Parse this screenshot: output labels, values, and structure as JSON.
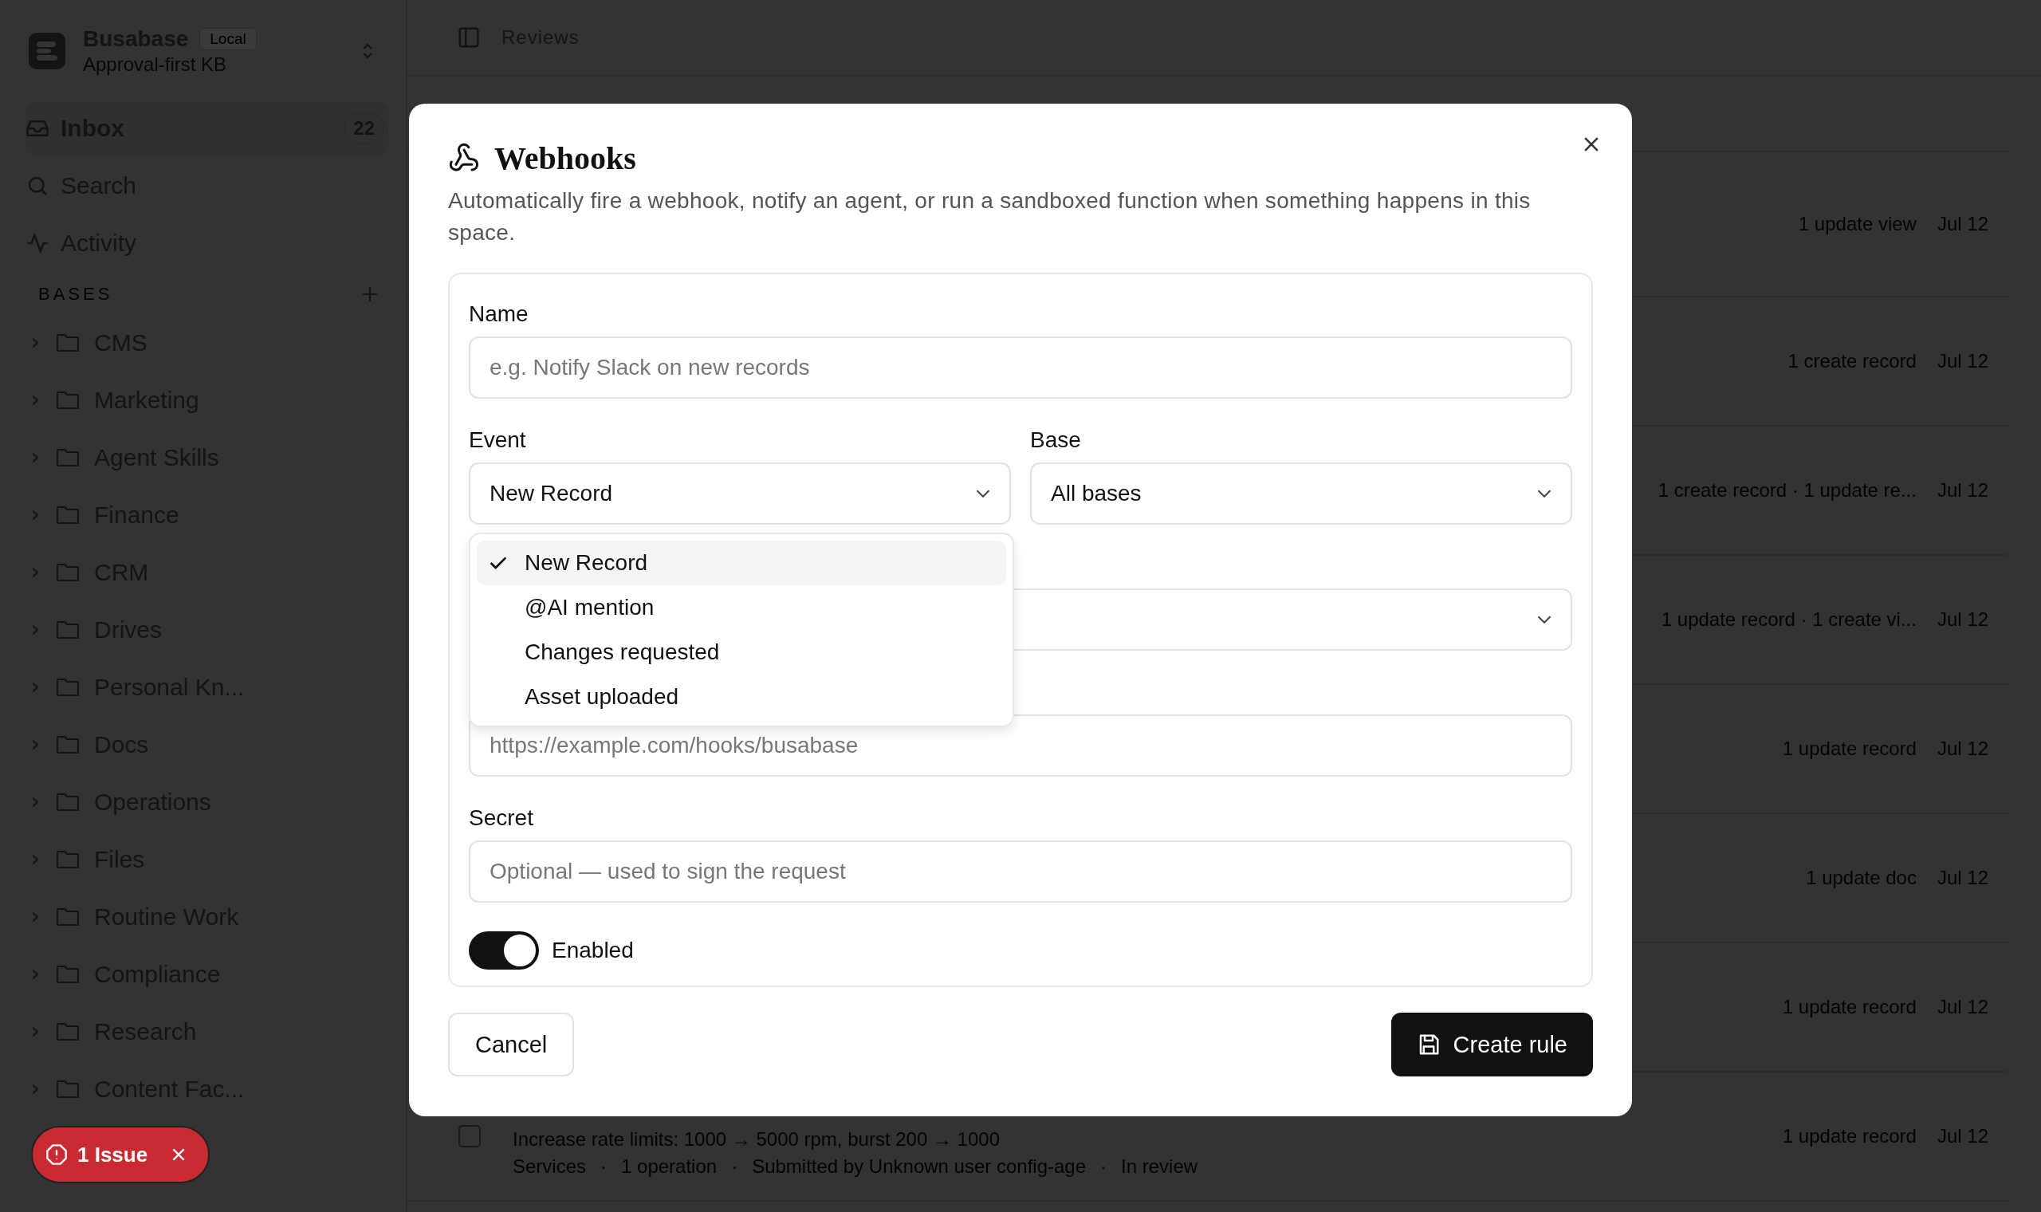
{
  "sidebar": {
    "workspace": {
      "name": "Busabase",
      "badge": "Local",
      "subtitle": "Approval-first KB"
    },
    "nav": [
      {
        "label": "Inbox",
        "count": "22",
        "selected": true
      },
      {
        "label": "Search",
        "selected": false
      },
      {
        "label": "Activity",
        "selected": false
      }
    ],
    "section_title": "BASES",
    "bases": [
      {
        "label": "CMS",
        "expanded": false
      },
      {
        "label": "Marketing",
        "expanded": false
      },
      {
        "label": "Agent Skills",
        "expanded": false
      },
      {
        "label": "Finance",
        "expanded": false
      },
      {
        "label": "CRM",
        "expanded": false
      },
      {
        "label": "Drives",
        "expanded": false
      },
      {
        "label": "Personal Kn...",
        "expanded": false
      },
      {
        "label": "Docs",
        "expanded": false
      },
      {
        "label": "Operations",
        "expanded": false
      },
      {
        "label": "Files",
        "expanded": false
      },
      {
        "label": "Routine Work",
        "expanded": false
      },
      {
        "label": "Compliance",
        "expanded": false
      },
      {
        "label": "Research",
        "expanded": false
      },
      {
        "label": "Content Fac...",
        "expanded": false
      }
    ]
  },
  "issue_pill": {
    "label": "1 Issue"
  },
  "header": {
    "title": "Reviews"
  },
  "reviews": [
    {
      "summary": "1 update view",
      "date": "Jul 12"
    },
    {
      "summary": "1 create record",
      "date": "Jul 12"
    },
    {
      "summary": "1 create record · 1 update re...",
      "date": "Jul 12"
    },
    {
      "summary": "1 update record · 1 create vi...",
      "date": "Jul 12"
    },
    {
      "summary": "1 update record",
      "date": "Jul 12"
    },
    {
      "summary": "1 update doc",
      "date": "Jul 12"
    },
    {
      "summary": "1 update record",
      "date": "Jul 12"
    },
    {
      "summary": "1 update record",
      "date": "Jul 12",
      "checked": false,
      "description": "Increase rate limits: 1000 → 5000 rpm, burst 200 → 1000",
      "meta": [
        "Services",
        "1 operation",
        "Submitted by Unknown user config-age",
        "In review"
      ],
      "separator": "·"
    }
  ],
  "dialog": {
    "title": "Webhooks",
    "description": "Automatically fire a webhook, notify an agent, or run a sandboxed function when something happens in this space.",
    "rows": [
      [
        {
          "kind": "text",
          "label": "Name",
          "placeholder": "e.g. Notify Slack on new records"
        }
      ],
      [
        {
          "kind": "select",
          "label": "Event",
          "value": "New Record",
          "options": [
            {
              "label": "New Record",
              "selected": true
            },
            {
              "label": "@AI mention",
              "selected": false
            },
            {
              "label": "Changes requested",
              "selected": false
            },
            {
              "label": "Asset uploaded",
              "selected": false
            }
          ]
        },
        {
          "kind": "select",
          "label": "Base",
          "value": "All bases"
        }
      ],
      [
        {
          "kind": "select"
        }
      ],
      [
        {
          "kind": "text",
          "placeholder": "https://example.com/hooks/busabase"
        }
      ],
      [
        {
          "kind": "text",
          "label": "Secret",
          "placeholder": "Optional — used to sign the request"
        }
      ]
    ],
    "toggle": {
      "label": "Enabled",
      "on": true
    },
    "buttons": [
      {
        "label": "Cancel",
        "kind": "secondary"
      },
      {
        "label": "Create rule",
        "kind": "primary"
      }
    ]
  }
}
